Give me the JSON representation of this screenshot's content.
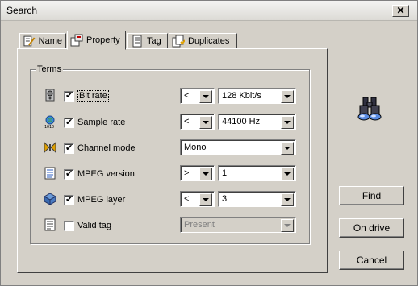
{
  "window": {
    "title": "Search",
    "close_label": "✕"
  },
  "tabs": [
    {
      "label": "Name",
      "icon": "pencil-doc-icon"
    },
    {
      "label": "Property",
      "icon": "property-icon"
    },
    {
      "label": "Tag",
      "icon": "tag-doc-icon"
    },
    {
      "label": "Duplicates",
      "icon": "duplicates-icon"
    }
  ],
  "active_tab": "Property",
  "terms": {
    "label": "Terms",
    "rows": [
      {
        "name": "bit-rate",
        "icon": "speaker-icon",
        "label": "Bit rate",
        "checked": true,
        "operator": "<",
        "value": "128 Kbit/s",
        "enabled": true
      },
      {
        "name": "sample-rate",
        "icon": "globe-sample-icon",
        "label": "Sample rate",
        "checked": true,
        "operator": "<",
        "value": "44100 Hz",
        "enabled": true
      },
      {
        "name": "channel-mode",
        "icon": "channel-icon",
        "label": "Channel mode",
        "checked": true,
        "operator": null,
        "value": "Mono",
        "enabled": true
      },
      {
        "name": "mpeg-version",
        "icon": "mpeg-version-icon",
        "label": "MPEG version",
        "checked": true,
        "operator": ">",
        "value": "1",
        "enabled": true
      },
      {
        "name": "mpeg-layer",
        "icon": "mpeg-layer-icon",
        "label": "MPEG layer",
        "checked": true,
        "operator": "<",
        "value": "3",
        "enabled": true
      },
      {
        "name": "valid-tag",
        "icon": "valid-tag-icon",
        "label": "Valid tag",
        "checked": false,
        "operator": null,
        "value": "Present",
        "enabled": false
      }
    ]
  },
  "buttons": {
    "find": "Find",
    "on_drive": "On drive",
    "cancel": "Cancel"
  }
}
